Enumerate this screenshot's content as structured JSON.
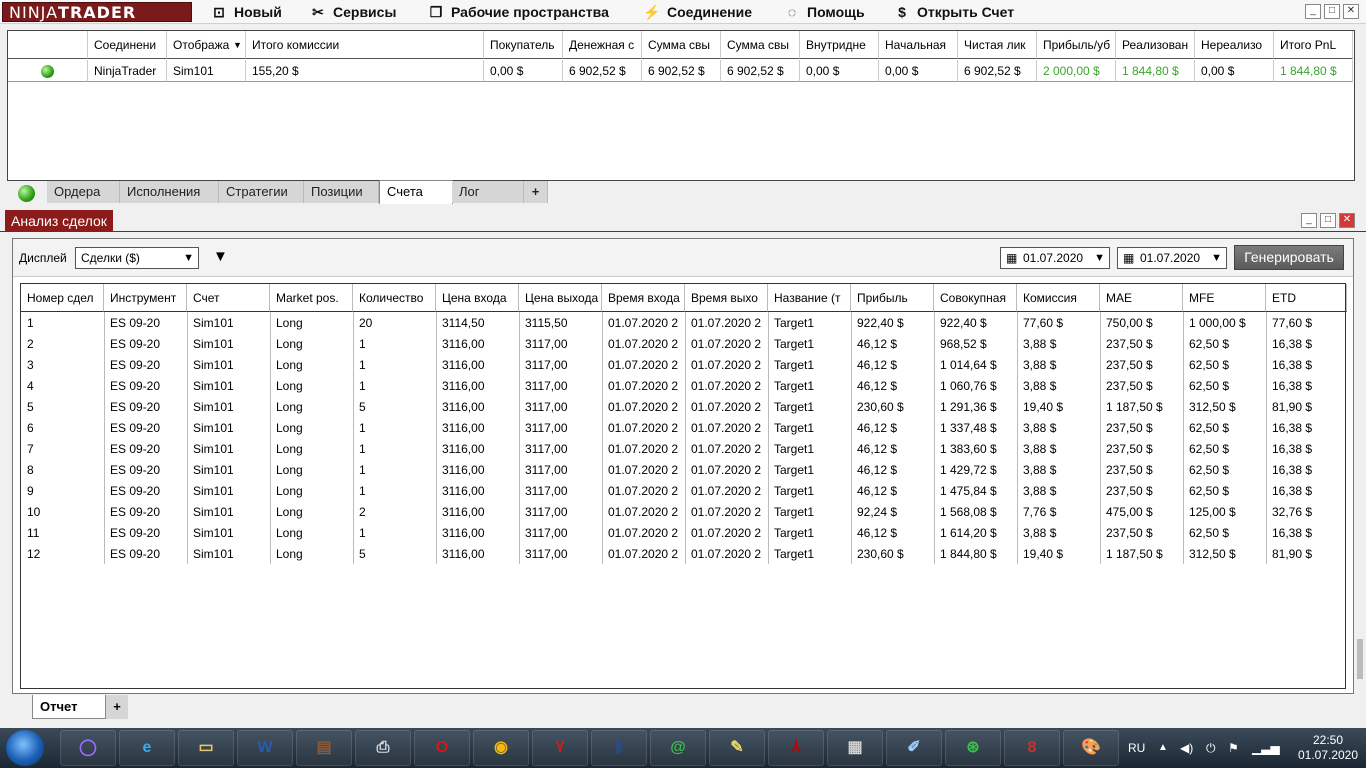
{
  "app": {
    "logo_left": "NINJA",
    "logo_right": "TRADER"
  },
  "menu": [
    {
      "label": "Новый",
      "icon": "new-window-icon",
      "glyph": "⊡"
    },
    {
      "label": "Сервисы",
      "icon": "tools-icon",
      "glyph": "✂"
    },
    {
      "label": "Рабочие пространства",
      "icon": "workspace-icon",
      "glyph": "❐"
    },
    {
      "label": "Соединение",
      "icon": "plug-icon",
      "glyph": "⚡"
    },
    {
      "label": "Помощь",
      "icon": "help-icon",
      "glyph": "◌"
    },
    {
      "label": "Открыть Счет",
      "icon": "dollar-icon",
      "glyph": "$"
    }
  ],
  "accounts": {
    "columns": [
      "",
      "Соединени",
      "Отобража",
      "Итого комиссии",
      "Покупатель",
      "Денежная с",
      "Сумма свы",
      "Сумма свы",
      "Внутридне",
      "Начальная",
      "Чистая лик",
      "Прибыль/уб",
      "Реализован",
      "Нереализо",
      "Итого PnL"
    ],
    "rows": [
      [
        "",
        "NinjaTrader",
        "Sim101",
        "155,20 $",
        "0,00 $",
        "6 902,52 $",
        "6 902,52 $",
        "6 902,52 $",
        "0,00 $",
        "0,00 $",
        "6 902,52 $",
        "2 000,00 $",
        "1 844,80 $",
        "0,00 $",
        "1 844,80 $"
      ]
    ],
    "green_columns": [
      11,
      12,
      14
    ]
  },
  "cc_tabs": [
    "Ордера",
    "Исполнения",
    "Стратегии",
    "Позиции",
    "Счета",
    "Лог",
    "+"
  ],
  "cc_active_tab": "Счета",
  "trade_performance": {
    "title": "Анализ сделок",
    "display_label": "Дисплей",
    "display_value": "Сделки ($)",
    "from_date": "01.07.2020",
    "to_date": "01.07.2020",
    "generate_label": "Генерировать",
    "columns": [
      "Номер сдел",
      "Инструмент",
      "Счет",
      "Market pos.",
      "Количество",
      "Цена входа",
      "Цена выхода",
      "Время входа",
      "Время выхо",
      "Название (т",
      "Прибыль",
      "Совокупная",
      "Комиссия",
      "MAE",
      "MFE",
      "ETD"
    ],
    "rows": [
      [
        "1",
        "ES 09-20",
        "Sim101",
        "Long",
        "20",
        "3114,50",
        "3115,50",
        "01.07.2020 2",
        "01.07.2020 2",
        "Target1",
        "922,40 $",
        "922,40 $",
        "77,60 $",
        "750,00 $",
        "1 000,00 $",
        "77,60 $"
      ],
      [
        "2",
        "ES 09-20",
        "Sim101",
        "Long",
        "1",
        "3116,00",
        "3117,00",
        "01.07.2020 2",
        "01.07.2020 2",
        "Target1",
        "46,12 $",
        "968,52 $",
        "3,88 $",
        "237,50 $",
        "62,50 $",
        "16,38 $"
      ],
      [
        "3",
        "ES 09-20",
        "Sim101",
        "Long",
        "1",
        "3116,00",
        "3117,00",
        "01.07.2020 2",
        "01.07.2020 2",
        "Target1",
        "46,12 $",
        "1 014,64 $",
        "3,88 $",
        "237,50 $",
        "62,50 $",
        "16,38 $"
      ],
      [
        "4",
        "ES 09-20",
        "Sim101",
        "Long",
        "1",
        "3116,00",
        "3117,00",
        "01.07.2020 2",
        "01.07.2020 2",
        "Target1",
        "46,12 $",
        "1 060,76 $",
        "3,88 $",
        "237,50 $",
        "62,50 $",
        "16,38 $"
      ],
      [
        "5",
        "ES 09-20",
        "Sim101",
        "Long",
        "5",
        "3116,00",
        "3117,00",
        "01.07.2020 2",
        "01.07.2020 2",
        "Target1",
        "230,60 $",
        "1 291,36 $",
        "19,40 $",
        "1 187,50 $",
        "312,50 $",
        "81,90 $"
      ],
      [
        "6",
        "ES 09-20",
        "Sim101",
        "Long",
        "1",
        "3116,00",
        "3117,00",
        "01.07.2020 2",
        "01.07.2020 2",
        "Target1",
        "46,12 $",
        "1 337,48 $",
        "3,88 $",
        "237,50 $",
        "62,50 $",
        "16,38 $"
      ],
      [
        "7",
        "ES 09-20",
        "Sim101",
        "Long",
        "1",
        "3116,00",
        "3117,00",
        "01.07.2020 2",
        "01.07.2020 2",
        "Target1",
        "46,12 $",
        "1 383,60 $",
        "3,88 $",
        "237,50 $",
        "62,50 $",
        "16,38 $"
      ],
      [
        "8",
        "ES 09-20",
        "Sim101",
        "Long",
        "1",
        "3116,00",
        "3117,00",
        "01.07.2020 2",
        "01.07.2020 2",
        "Target1",
        "46,12 $",
        "1 429,72 $",
        "3,88 $",
        "237,50 $",
        "62,50 $",
        "16,38 $"
      ],
      [
        "9",
        "ES 09-20",
        "Sim101",
        "Long",
        "1",
        "3116,00",
        "3117,00",
        "01.07.2020 2",
        "01.07.2020 2",
        "Target1",
        "46,12 $",
        "1 475,84 $",
        "3,88 $",
        "237,50 $",
        "62,50 $",
        "16,38 $"
      ],
      [
        "10",
        "ES 09-20",
        "Sim101",
        "Long",
        "2",
        "3116,00",
        "3117,00",
        "01.07.2020 2",
        "01.07.2020 2",
        "Target1",
        "92,24 $",
        "1 568,08 $",
        "7,76 $",
        "475,00 $",
        "125,00 $",
        "32,76 $"
      ],
      [
        "11",
        "ES 09-20",
        "Sim101",
        "Long",
        "1",
        "3116,00",
        "3117,00",
        "01.07.2020 2",
        "01.07.2020 2",
        "Target1",
        "46,12 $",
        "1 614,20 $",
        "3,88 $",
        "237,50 $",
        "62,50 $",
        "16,38 $"
      ],
      [
        "12",
        "ES 09-20",
        "Sim101",
        "Long",
        "5",
        "3116,00",
        "3117,00",
        "01.07.2020 2",
        "01.07.2020 2",
        "Target1",
        "230,60 $",
        "1 844,80 $",
        "19,40 $",
        "1 187,50 $",
        "312,50 $",
        "81,90 $"
      ]
    ]
  },
  "report_tabs": [
    "Отчет",
    "+"
  ],
  "taskbar": {
    "apps": [
      "alice-icon",
      "ie-icon",
      "explorer-icon",
      "word-icon",
      "winrar-icon",
      "printer-icon",
      "opera-icon",
      "chrome-icon",
      "yandex-icon",
      "bluetooth-icon",
      "mail-icon",
      "notes-icon",
      "pdf-icon",
      "calculator-icon",
      "edit-icon",
      "metatrader-icon",
      "ninjatrader-icon",
      "paint-icon"
    ],
    "lang": "RU",
    "time": "22:50",
    "date": "01.07.2020"
  },
  "colors": {
    "brand": "#8c1b1b",
    "profit_green": "#3aa52b",
    "taskbar": "#1b2733"
  }
}
